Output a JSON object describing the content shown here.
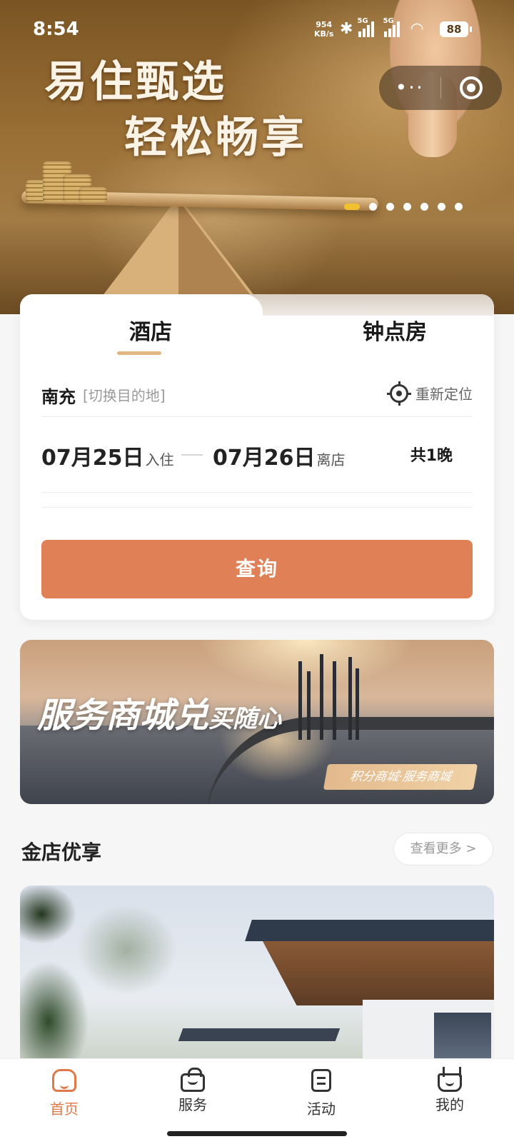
{
  "status_bar": {
    "time": "8:54",
    "net_speed": "954",
    "net_unit": "KB/s",
    "sim1": "5G",
    "sim2": "5G",
    "battery": "88"
  },
  "capsule": {
    "more_label": "•··",
    "close_icon": "target-icon"
  },
  "hero": {
    "line1": "易住甄选",
    "line2": "轻松畅享",
    "carousel_count": 7,
    "carousel_active": 1
  },
  "booking": {
    "tabs": [
      {
        "label": "酒店",
        "active": true
      },
      {
        "label": "钟点房",
        "active": false
      }
    ],
    "city": "南充",
    "switch_hint": "[切换目的地]",
    "relocate_label": "重新定位",
    "checkin_date": "07月25日",
    "checkin_label": "入住",
    "checkout_date": "07月26日",
    "checkout_label": "离店",
    "nights": "共1晚",
    "search_label": "查询"
  },
  "promo": {
    "title_main": "服务商城兑",
    "title_small": "买随心",
    "tag": "积分商城·服务商城"
  },
  "section": {
    "title": "金店优享",
    "more_label": "查看更多 >"
  },
  "tabbar": {
    "items": [
      {
        "label": "首页",
        "icon": "home-icon",
        "active": true
      },
      {
        "label": "服务",
        "icon": "bag-icon",
        "active": false
      },
      {
        "label": "活动",
        "icon": "document-icon",
        "active": false
      },
      {
        "label": "我的",
        "icon": "basket-icon",
        "active": false
      }
    ]
  },
  "colors": {
    "accent": "#e0784a",
    "search_button": "#e08057",
    "tab_underline": "#e3b682",
    "carousel_active": "#f2c12e"
  }
}
